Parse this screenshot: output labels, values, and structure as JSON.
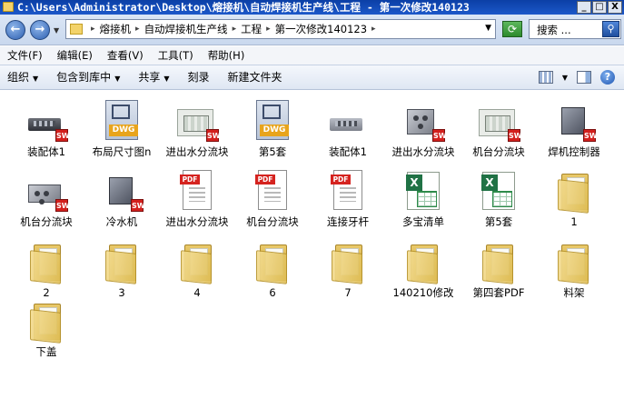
{
  "window": {
    "title": "C:\\Users\\Administrator\\Desktop\\熔接机\\自动焊接机生产线\\工程 - 第一次修改140123",
    "controls": [
      "_",
      "□",
      "X"
    ]
  },
  "address": {
    "crumbs": [
      "熔接机",
      "自动焊接机生产线",
      "工程",
      "第一次修改140123"
    ]
  },
  "search": {
    "placeholder": "搜索 ..."
  },
  "menu": [
    "文件(F)",
    "编辑(E)",
    "查看(V)",
    "工具(T)",
    "帮助(H)"
  ],
  "toolbar": {
    "organize": "组织",
    "include": "包含到库中",
    "share": "共享",
    "burn": "刻录",
    "new_folder": "新建文件夹"
  },
  "files": [
    {
      "label": "装配体1",
      "kind": "sw-assembly"
    },
    {
      "label": "布局尺寸图n",
      "kind": "dwg"
    },
    {
      "label": "进出水分流块",
      "kind": "sw-drawing"
    },
    {
      "label": "第5套",
      "kind": "dwg"
    },
    {
      "label": "装配体1",
      "kind": "sw-assembly-plain"
    },
    {
      "label": "进出水分流块",
      "kind": "sw-part"
    },
    {
      "label": "机台分流块",
      "kind": "sw-drawing"
    },
    {
      "label": "焊机控制器",
      "kind": "sw-box"
    },
    {
      "label": "机台分流块",
      "kind": "sw-part"
    },
    {
      "label": "冷水机",
      "kind": "sw-box"
    },
    {
      "label": "进出水分流块",
      "kind": "pdf"
    },
    {
      "label": "机台分流块",
      "kind": "pdf"
    },
    {
      "label": "连接牙杆",
      "kind": "pdf"
    },
    {
      "label": "多宝清单",
      "kind": "xls"
    },
    {
      "label": "第5套",
      "kind": "xls"
    },
    {
      "label": "1",
      "kind": "folder"
    },
    {
      "label": "2",
      "kind": "folder"
    },
    {
      "label": "3",
      "kind": "folder"
    },
    {
      "label": "4",
      "kind": "folder"
    },
    {
      "label": "6",
      "kind": "folder"
    },
    {
      "label": "7",
      "kind": "folder"
    },
    {
      "label": "140210修改",
      "kind": "folder"
    },
    {
      "label": "第四套PDF",
      "kind": "folder"
    },
    {
      "label": "料架",
      "kind": "folder"
    },
    {
      "label": "下盖",
      "kind": "folder"
    }
  ]
}
